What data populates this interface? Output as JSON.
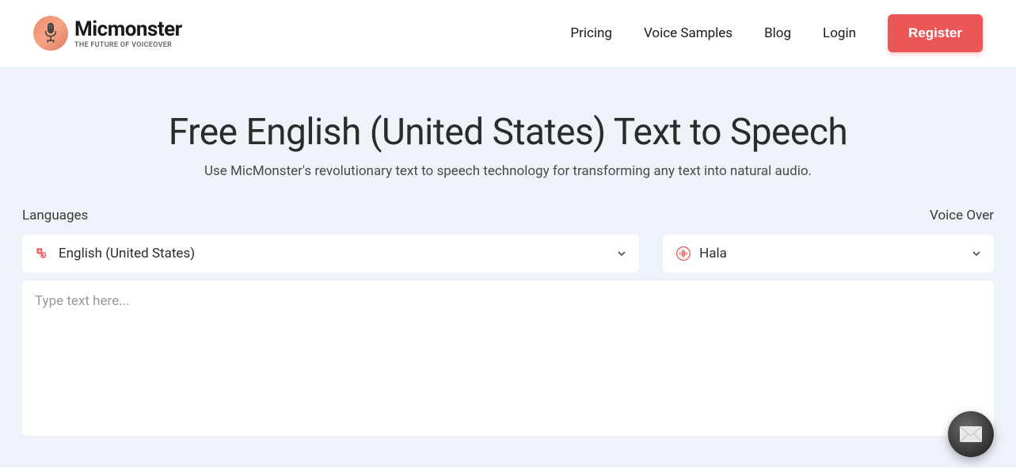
{
  "header": {
    "logo": {
      "title": "Micmonster",
      "subtitle": "THE FUTURE OF VOICEOVER"
    },
    "nav": {
      "pricing": "Pricing",
      "voiceSamples": "Voice Samples",
      "blog": "Blog",
      "login": "Login",
      "register": "Register"
    }
  },
  "main": {
    "title": "Free English (United States) Text to Speech",
    "subtitle": "Use MicMonster's revolutionary text to speech technology for transforming any text into natural audio.",
    "labels": {
      "languages": "Languages",
      "voiceOver": "Voice Over"
    },
    "selects": {
      "language": "English (United States)",
      "voice": "Hala"
    },
    "textarea": {
      "placeholder": "Type text here..."
    }
  }
}
